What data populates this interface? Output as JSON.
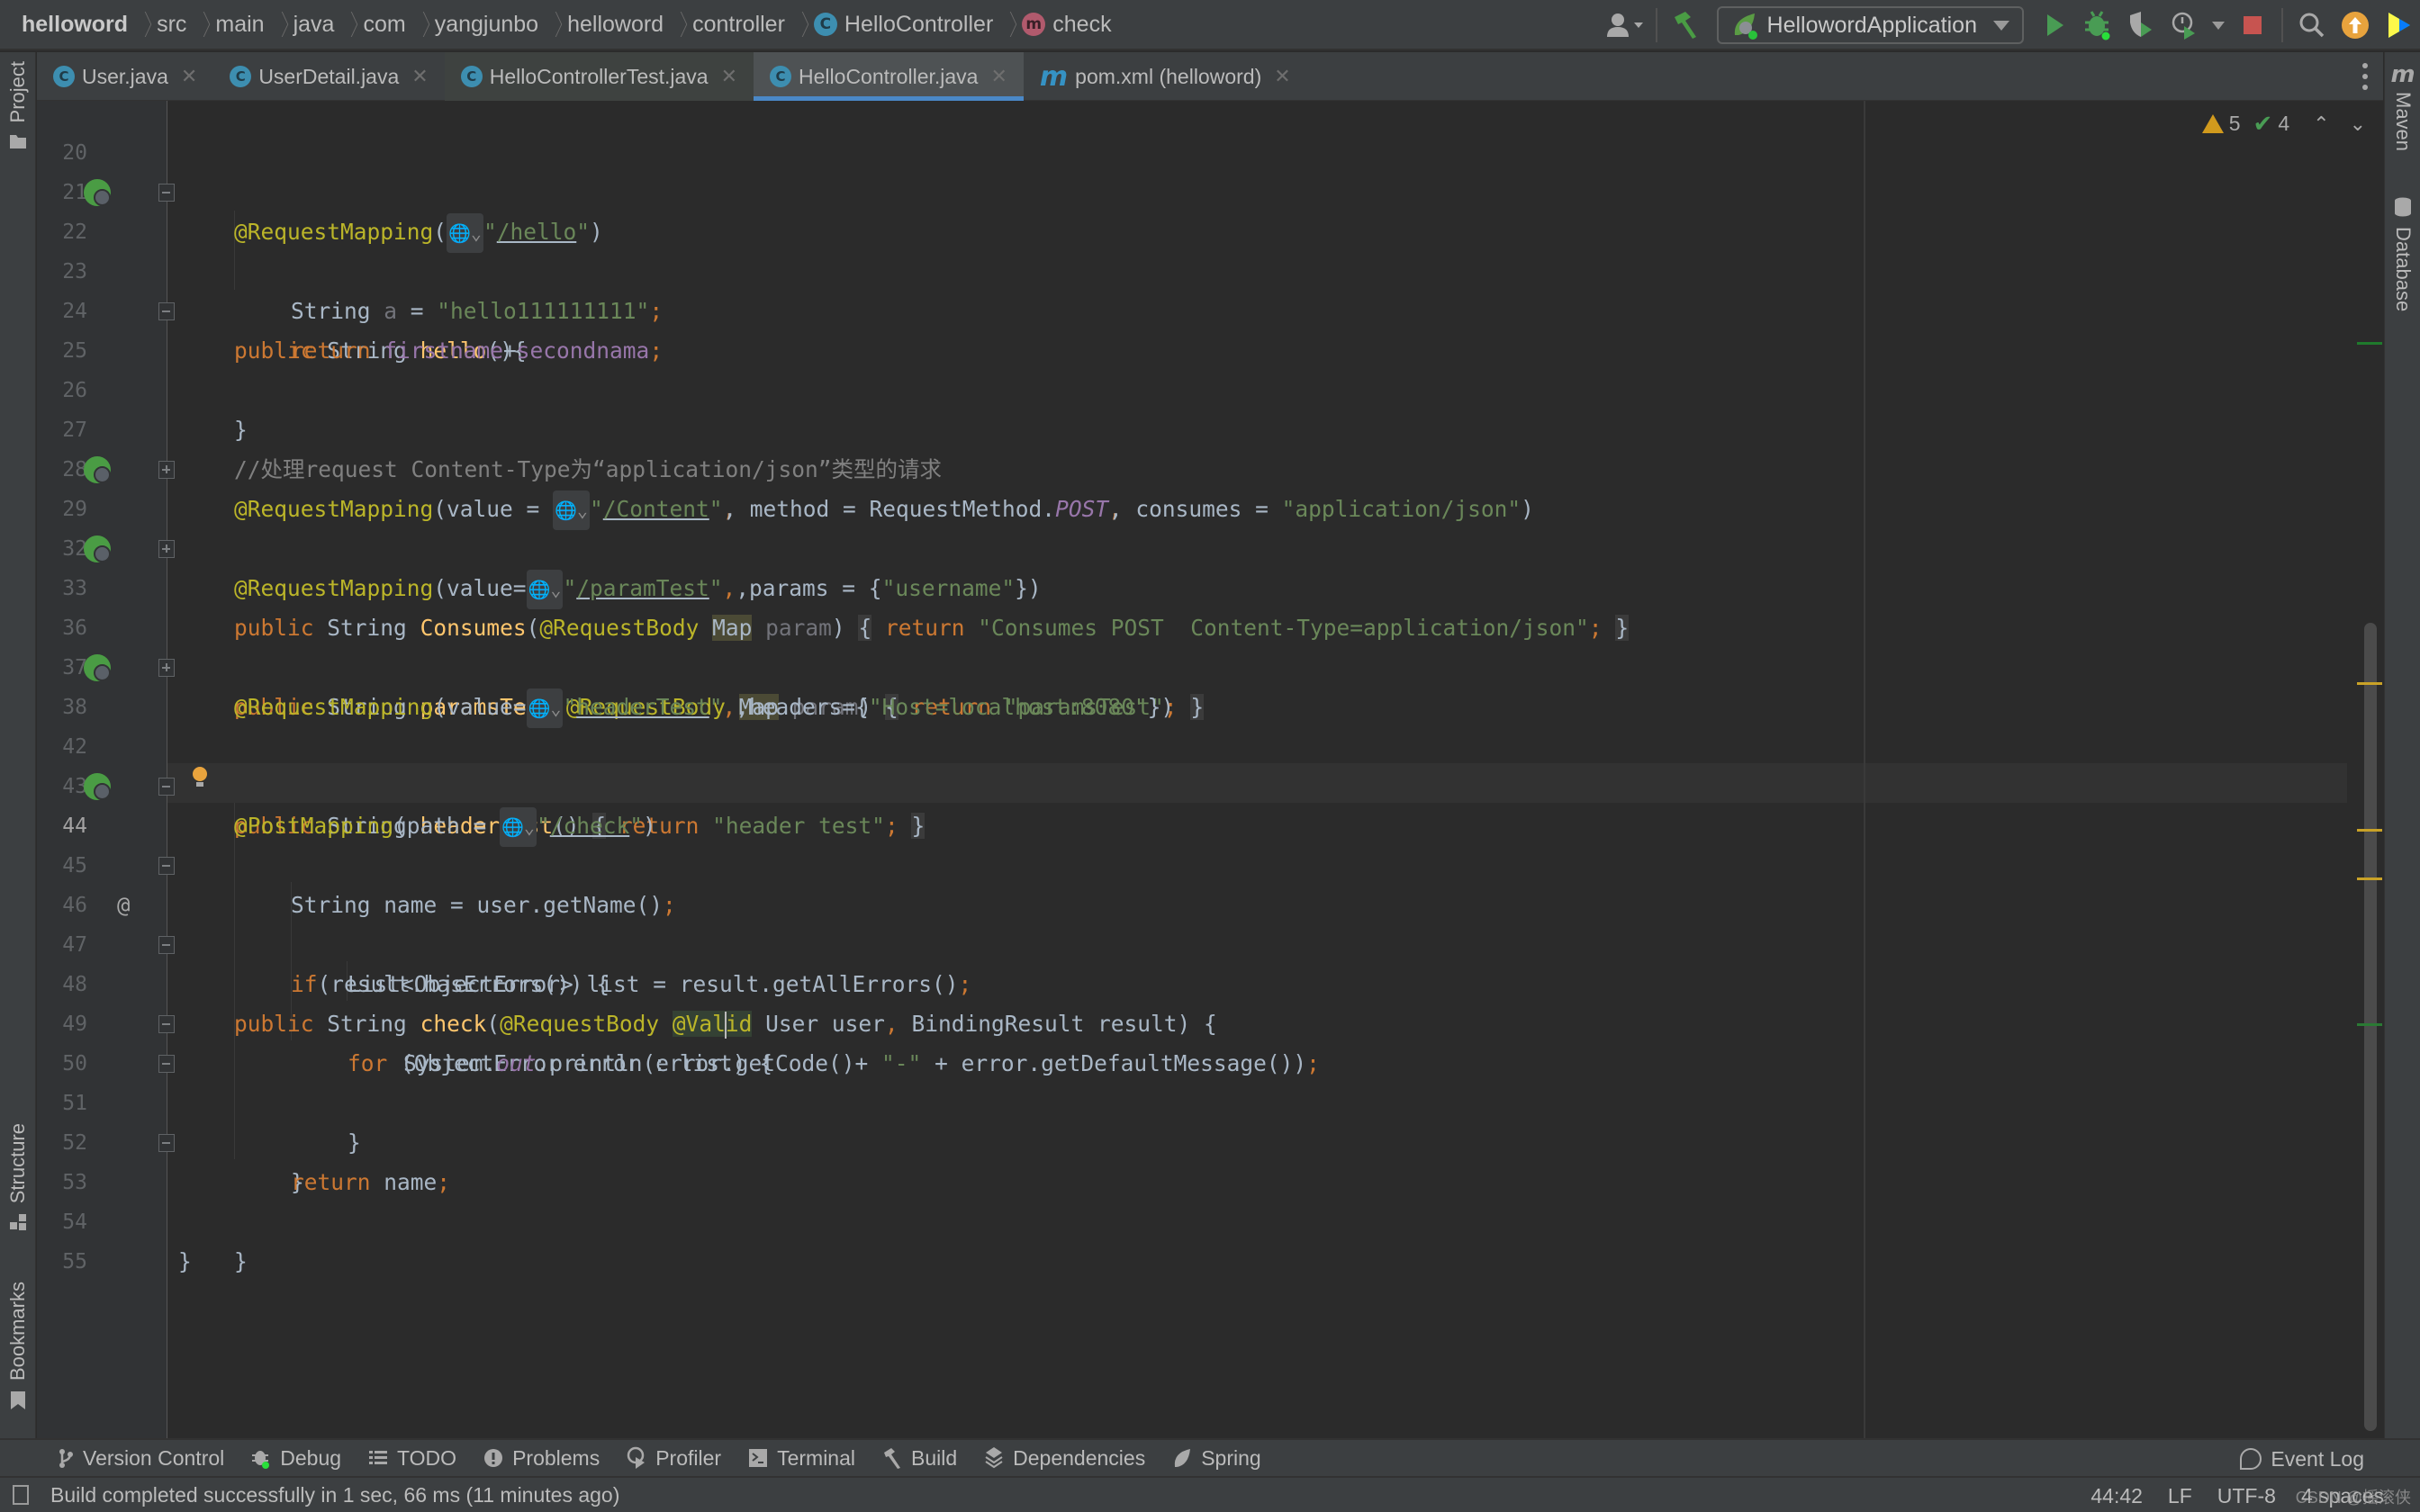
{
  "breadcrumb": {
    "items": [
      "helloword",
      "src",
      "main",
      "java",
      "com",
      "yangjunbo",
      "helloword",
      "controller",
      "HelloController",
      "check"
    ],
    "class_icon_letter": "C",
    "method_icon_letter": "m"
  },
  "toolbar": {
    "run_config": "HellowordApplication",
    "icons": [
      "user-dropdown-icon",
      "build-hammer-icon",
      "run-icon",
      "debug-icon",
      "coverage-icon",
      "profile-icon",
      "stop-icon",
      "search-icon",
      "update-icon",
      "toolbox-icon"
    ]
  },
  "tabs": [
    {
      "label": "User.java",
      "icon": "C",
      "state": "normal"
    },
    {
      "label": "UserDetail.java",
      "icon": "C",
      "state": "normal"
    },
    {
      "label": "HelloControllerTest.java",
      "icon": "C",
      "state": "test"
    },
    {
      "label": "HelloController.java",
      "icon": "C",
      "state": "active"
    },
    {
      "label": "pom.xml (helloword)",
      "icon": "m",
      "state": "normal"
    }
  ],
  "tab_close_glyph": "✕",
  "side_tools": {
    "left": [
      "Project",
      "Structure",
      "Bookmarks"
    ],
    "right": [
      "Maven",
      "Database"
    ]
  },
  "inspections": {
    "warnings": "5",
    "typos": "4",
    "up": "⌃",
    "down": "⌄"
  },
  "editor": {
    "caret_line": "44",
    "lines": [
      {
        "n": "20"
      },
      {
        "n": "21",
        "t": "@RequestMapping(",
        "path": "/hello"
      },
      {
        "n": "22",
        "sig": "hello"
      },
      {
        "n": "23",
        "s1": "String ",
        "var": "a",
        "s2": " = ",
        "str": "\"hello111111111\"",
        "semi": ";"
      },
      {
        "n": "24",
        "ret": "return ",
        "f1": "firstname",
        "plus": "+",
        "f2": "secondnama",
        "semi": ";"
      },
      {
        "n": "25",
        "brace": "}"
      },
      {
        "n": "26"
      },
      {
        "n": "27",
        "comment": "//处理request Content-Type为“application/json”类型的请求"
      },
      {
        "n": "28",
        "ann": "@RequestMapping",
        "p1": "(value = ",
        "path": "/Content",
        "p2": ", method = RequestMethod.",
        "post": "POST",
        "p3": ", consumes = ",
        "str": "\"application/json\"",
        "p4": ")"
      },
      {
        "n": "29",
        "fn": "Consumes",
        "ann": "@RequestBody",
        "type": "Map",
        "param": "param",
        "retstr": "\"Consumes POST  Content-Type=application/json\""
      },
      {
        "n": "32",
        "ann": "@RequestMapping",
        "p1": "(value=",
        "path": "/paramTest",
        "p2": ",params = {",
        "str": "\"username\"",
        "p3": "})"
      },
      {
        "n": "33",
        "fn": "paramsTest",
        "ann": "@RequestBody",
        "type": "Map",
        "param": "param",
        "retstr": "\"paramsTest\""
      },
      {
        "n": "36"
      },
      {
        "n": "37",
        "ann": "@RequestMapping",
        "p1": "(value=",
        "path": "headerTest",
        "p2": ",headers={",
        "str": "\"Host=localhost:8080\"",
        "p3": "})"
      },
      {
        "n": "38",
        "fn": "headerTest",
        "retstr": "\"header test\""
      },
      {
        "n": "42"
      },
      {
        "n": "43",
        "ann": "@PostMapping",
        "p1": "(path = ",
        "path": "/check",
        "p2": ")"
      },
      {
        "n": "44",
        "fn": "check",
        "ann1": "@RequestBody",
        "ann2a": "@Val",
        "ann2b": "id",
        "rest": " User user",
        "comma": ",",
        "rest2": " BindingResult result) {"
      },
      {
        "n": "45",
        "a": "String name = user.getName()",
        "semi": ";"
      },
      {
        "n": "46",
        "kw": "if",
        "a": "(result.hasErrors()) {"
      },
      {
        "n": "47",
        "a": "List<ObjectError> list = result.getAllErrors()",
        "semi": ";"
      },
      {
        "n": "48",
        "kw": "for",
        "a": " (ObjectError error : list) {"
      },
      {
        "n": "49",
        "a": "System.",
        "out": "out",
        "b": ".println(error.getCode()+ ",
        "str": "\"-\"",
        "c": " + error.getDefaultMessage())",
        "semi": ";"
      },
      {
        "n": "50",
        "a": "}"
      },
      {
        "n": "51",
        "a": "}"
      },
      {
        "n": "52",
        "kw": "return",
        "a": " name",
        "semi": ";"
      },
      {
        "n": "53",
        "a": "}"
      },
      {
        "n": "54",
        "a": "}"
      },
      {
        "n": "55"
      }
    ],
    "keywords": {
      "public": "public",
      "string": "String",
      "return": "return",
      "empty_parens": "()",
      "open_brace": "{",
      "close_brace": "}",
      "paren_open": "(",
      "paren_close": ")",
      "semi": ";",
      "quote": "\"",
      "globe": "🌐⌄"
    }
  },
  "bottom_tools": [
    {
      "label": "Version Control",
      "icon": "branch-icon"
    },
    {
      "label": "Debug",
      "icon": "bug-icon"
    },
    {
      "label": "TODO",
      "icon": "list-icon"
    },
    {
      "label": "Problems",
      "icon": "problems-icon"
    },
    {
      "label": "Profiler",
      "icon": "profiler-icon"
    },
    {
      "label": "Terminal",
      "icon": "terminal-icon"
    },
    {
      "label": "Build",
      "icon": "hammer-icon"
    },
    {
      "label": "Dependencies",
      "icon": "layers-icon"
    },
    {
      "label": "Spring",
      "icon": "spring-leaf-icon"
    }
  ],
  "event_log": "Event Log",
  "status": {
    "message": "Build completed successfully in 1 sec, 66 ms (11 minutes ago)",
    "position": "44:42",
    "line_sep": "LF",
    "encoding": "UTF-8",
    "indent": "4 spaces",
    "watermark": "CSDN @摇滚侠"
  },
  "colors": {
    "accent": "#4a88c7",
    "warning": "#d19a1d",
    "success": "#499c54",
    "stop": "#c75450"
  }
}
